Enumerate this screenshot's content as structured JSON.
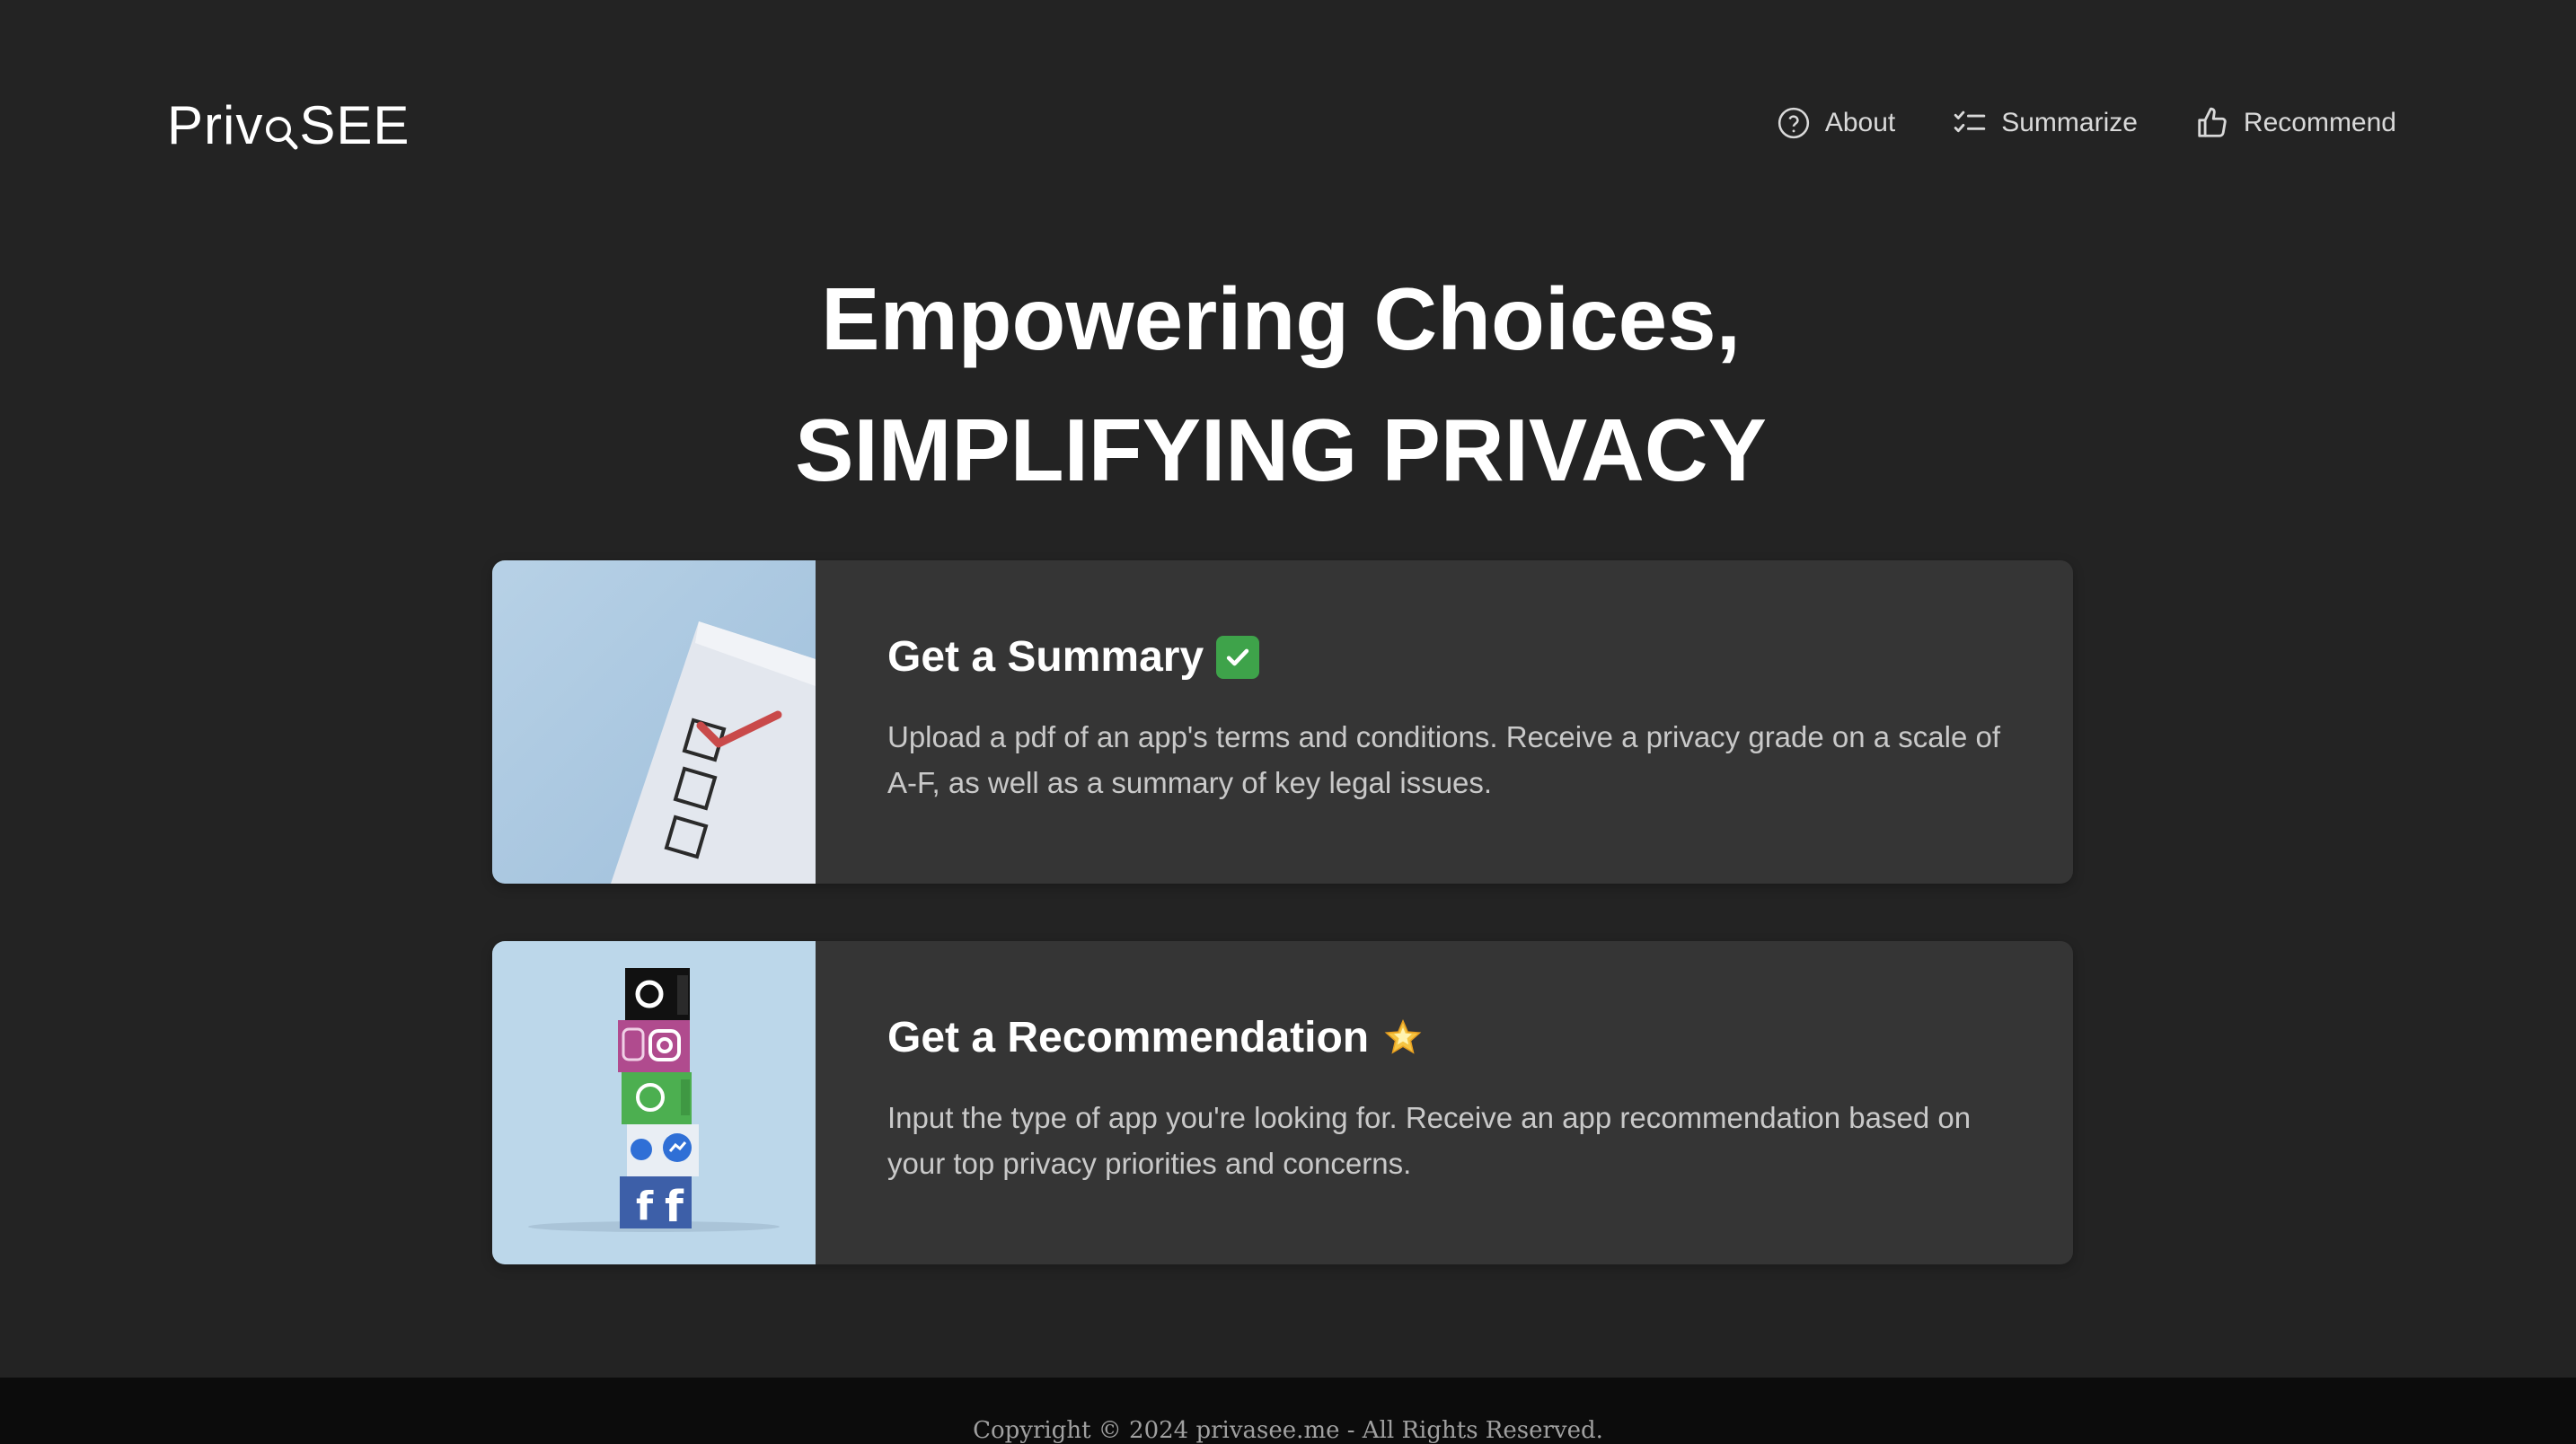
{
  "header": {
    "logo_left": "Priv",
    "logo_right": "SEE",
    "nav": [
      {
        "label": "About",
        "icon": "question-circle-icon"
      },
      {
        "label": "Summarize",
        "icon": "checklist-icon"
      },
      {
        "label": "Recommend",
        "icon": "thumbs-up-icon"
      }
    ]
  },
  "hero": {
    "line1": "Empowering Choices,",
    "line2": "SIMPLIFYING PRIVACY"
  },
  "cards": [
    {
      "title": "Get a Summary",
      "emoji": "check-mark-button-icon",
      "description": "Upload a pdf of an app's terms and conditions. Receive a privacy grade on a scale of A-F, as well as a summary of key legal issues."
    },
    {
      "title": "Get a Recommendation",
      "emoji": "glowing-star-icon",
      "description": "Input the type of app you're looking for. Receive an app recommendation based on your top privacy priorities and concerns."
    }
  ],
  "footer": {
    "copyright": "Copyright © 2024 privasee.me - All Rights Reserved."
  },
  "colors": {
    "background": "#232323",
    "card": "#353535",
    "footer": "#0c0c0c"
  }
}
